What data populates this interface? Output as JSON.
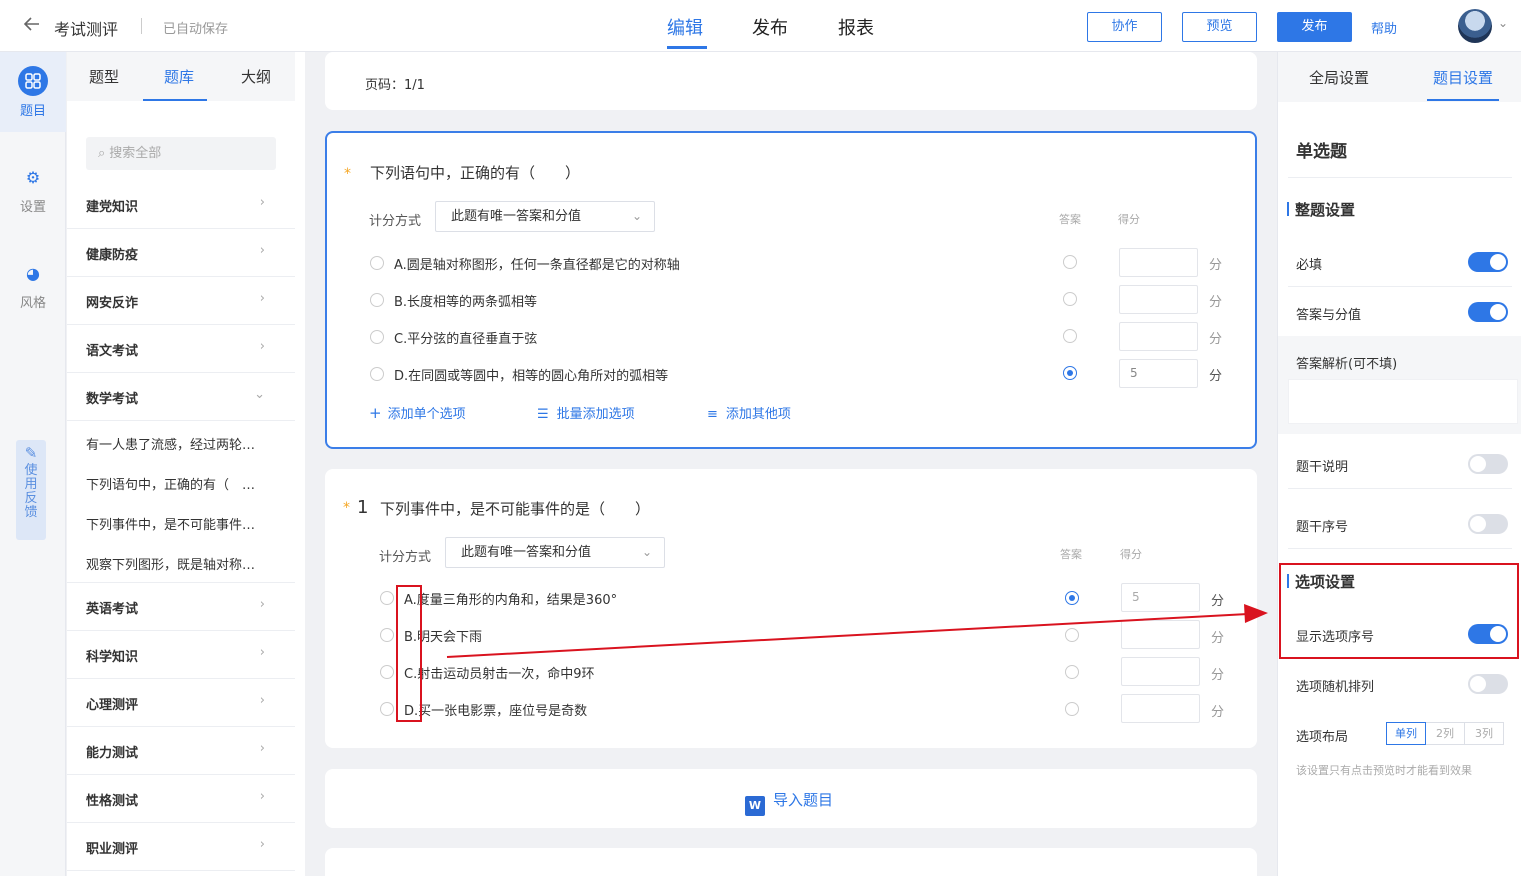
{
  "topbar": {
    "title": "考试测评",
    "autosave": "已自动保存",
    "tabs": [
      "编辑",
      "发布",
      "报表"
    ],
    "buttons": {
      "collab": "协作",
      "preview": "预览",
      "publish": "发布"
    },
    "help": "帮助"
  },
  "rail": {
    "items": [
      {
        "label": "题目",
        "icon": "grid-icon"
      },
      {
        "label": "设置",
        "icon": "gear-icon"
      },
      {
        "label": "风格",
        "icon": "palette-icon"
      }
    ],
    "feedback": [
      "使",
      "用",
      "反",
      "馈"
    ]
  },
  "library": {
    "tabs": [
      "题型",
      "题库",
      "大纲"
    ],
    "search_placeholder": "搜索全部",
    "categories_top": [
      "建党知识",
      "健康防疫",
      "网安反诈",
      "语文考试",
      "数学考试"
    ],
    "math_items": [
      "有一人患了流感，经过两轮…",
      "下列语句中，正确的有（　…",
      "下列事件中，是不可能事件…",
      "观察下列图形，既是轴对称…"
    ],
    "categories_bottom": [
      "英语考试",
      "科学知识",
      "心理测评",
      "能力测试",
      "性格测试",
      "职业测评"
    ]
  },
  "main": {
    "page": "页码：1/1",
    "q_active": {
      "star": "*",
      "text": "下列语句中，正确的有（　　）",
      "score_label": "计分方式",
      "score_mode": "此题有唯一答案和分值",
      "hdr_answer": "答案",
      "hdr_score": "得分",
      "options": [
        {
          "text": "A.圆是轴对称图形，任何一条直径都是它的对称轴",
          "score": ""
        },
        {
          "text": "B.长度相等的两条弧相等",
          "score": ""
        },
        {
          "text": "C.平分弦的直径垂直于弦",
          "score": ""
        },
        {
          "text": "D.在同圆或等圆中，相等的圆心角所对的弧相等",
          "score": "5"
        }
      ],
      "unit": "分",
      "add_single": "添加单个选项",
      "add_batch": "批量添加选项",
      "add_other": "添加其他项"
    },
    "q1": {
      "star": "*",
      "num": "1",
      "text": "下列事件中，是不可能事件的是（　　）",
      "score_label": "计分方式",
      "score_mode": "此题有唯一答案和分值",
      "hdr_answer": "答案",
      "hdr_score": "得分",
      "options": [
        {
          "text": "A.度量三角形的内角和，结果是360°",
          "score": "5"
        },
        {
          "text": "B.明天会下雨",
          "score": ""
        },
        {
          "text": "C.射击运动员射击一次，命中9环",
          "score": ""
        },
        {
          "text": "D.买一张电影票，座位号是奇数",
          "score": ""
        }
      ],
      "unit": "分"
    },
    "import": "导入题目",
    "import_icon": "W"
  },
  "right": {
    "tabs": [
      "全局设置",
      "题目设置"
    ],
    "type_title": "单选题",
    "sec_whole": "整题设置",
    "required": "必填",
    "answer_score": "答案与分值",
    "analysis": "答案解析(可不填)",
    "stem_desc": "题干说明",
    "stem_num": "题干序号",
    "sec_option": "选项设置",
    "show_opt_num": "显示选项序号",
    "opt_random": "选项随机排列",
    "opt_layout": "选项布局",
    "layout_options": [
      "单列",
      "2列",
      "3列"
    ],
    "note": "该设置只有点击预览时才能看到效果"
  },
  "colors": {
    "accent": "#2e77e6",
    "annotation": "#d9131f"
  }
}
